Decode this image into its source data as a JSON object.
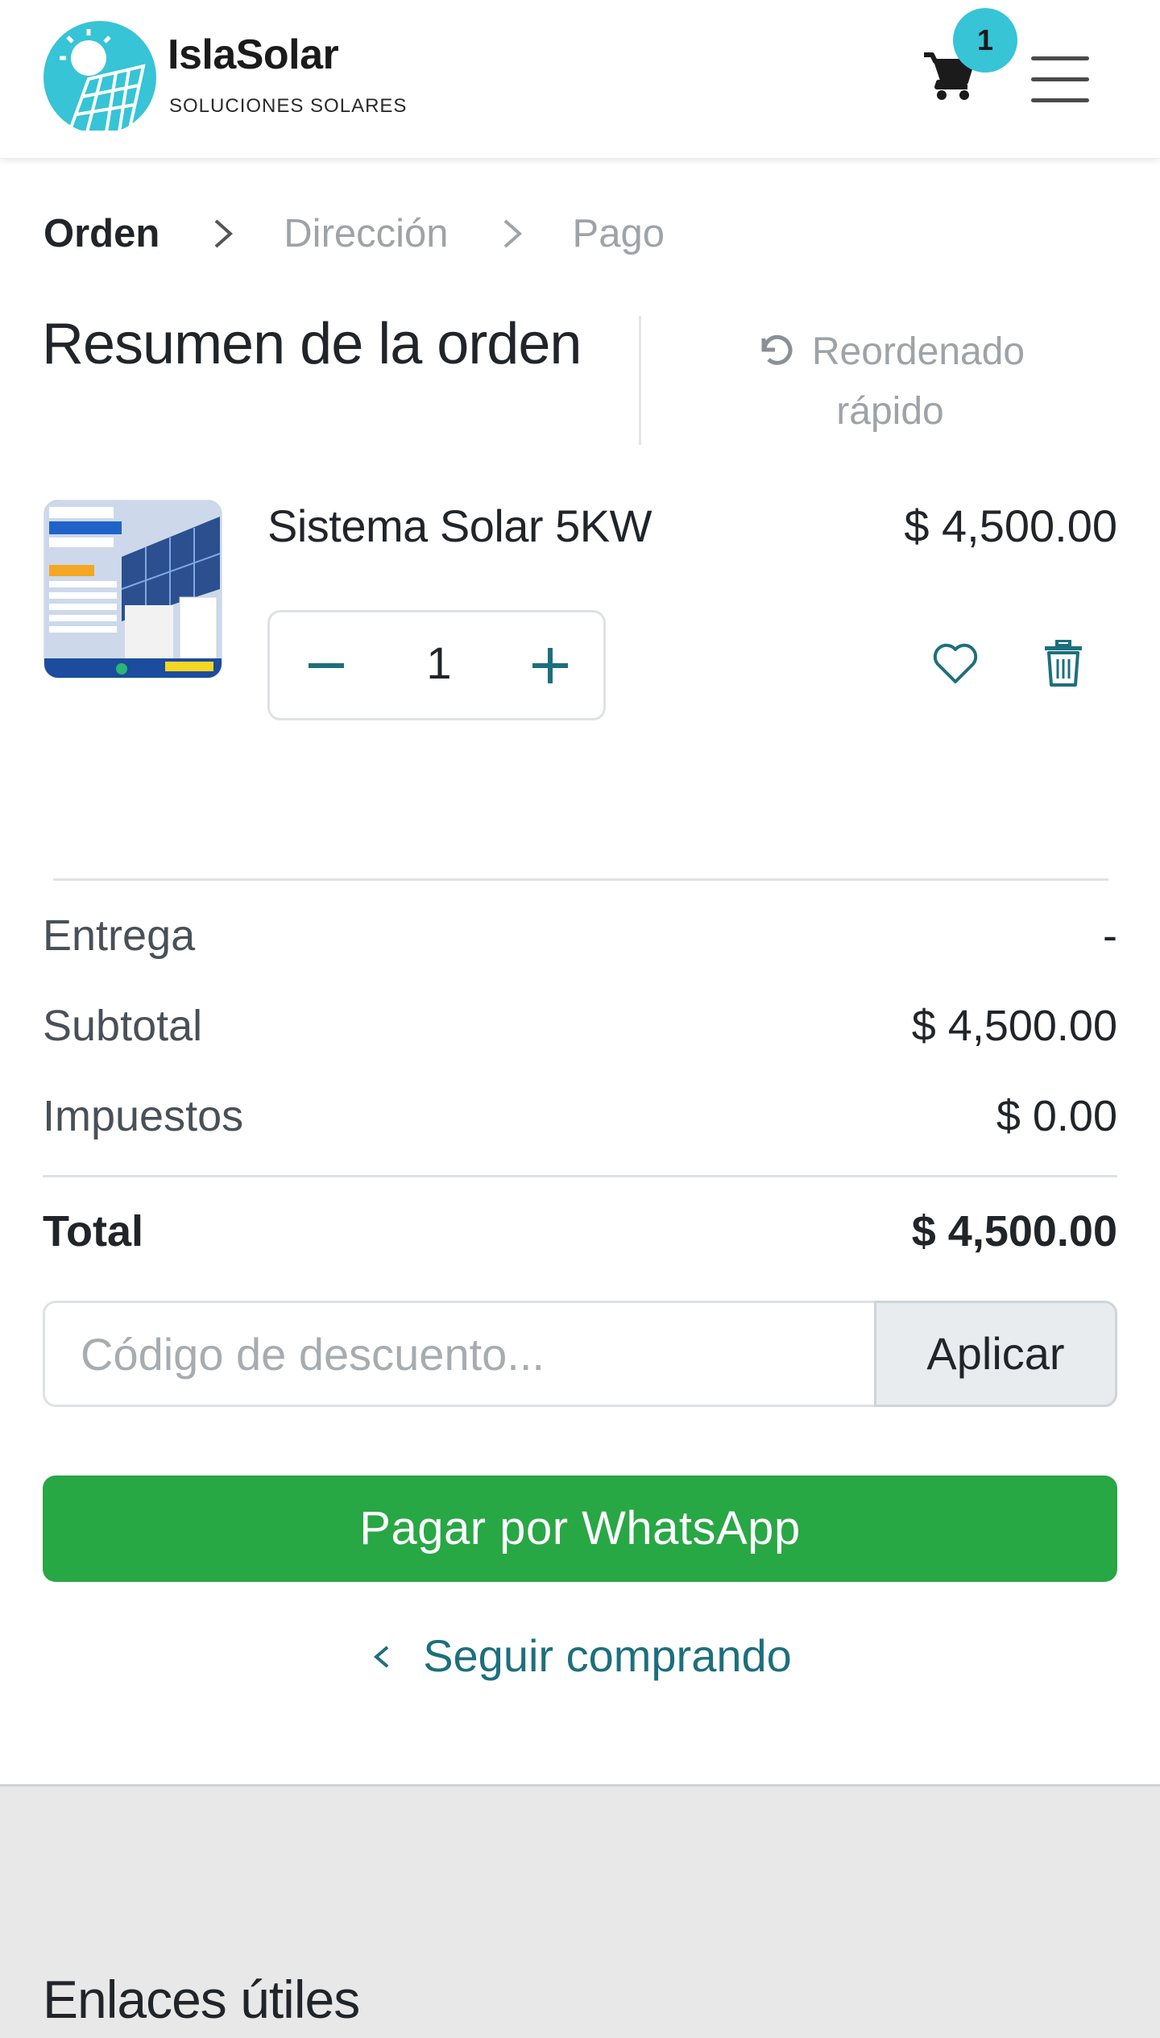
{
  "header": {
    "brand_name": "IslaSolar",
    "brand_tagline": "SOLUCIONES SOLARES",
    "cart_count": "1",
    "accent_color": "#36c4d6"
  },
  "steps": {
    "items": [
      "Orden",
      "Dirección",
      "Pago"
    ],
    "active_index": 0
  },
  "summary": {
    "title": "Resumen de la orden",
    "reorder_line1": "Reordenado",
    "reorder_line2": "rápido"
  },
  "cart_item": {
    "name": "Sistema Solar 5KW",
    "price": "$ 4,500.00",
    "quantity": "1",
    "image_icon": "solar-panel-product-image"
  },
  "totals": {
    "delivery_label": "Entrega",
    "delivery_value": "-",
    "subtotal_label": "Subtotal",
    "subtotal_value": "$ 4,500.00",
    "taxes_label": "Impuestos",
    "taxes_value": "$ 0.00",
    "total_label": "Total",
    "total_value": "$ 4,500.00"
  },
  "discount": {
    "placeholder": "Código de descuento...",
    "value": "",
    "apply_label": "Aplicar"
  },
  "actions": {
    "pay_label": "Pagar por WhatsApp",
    "pay_color": "#28a745",
    "continue_label": "Seguir comprando",
    "link_color": "#1d6f7d"
  },
  "footer": {
    "title": "Enlaces útiles"
  }
}
